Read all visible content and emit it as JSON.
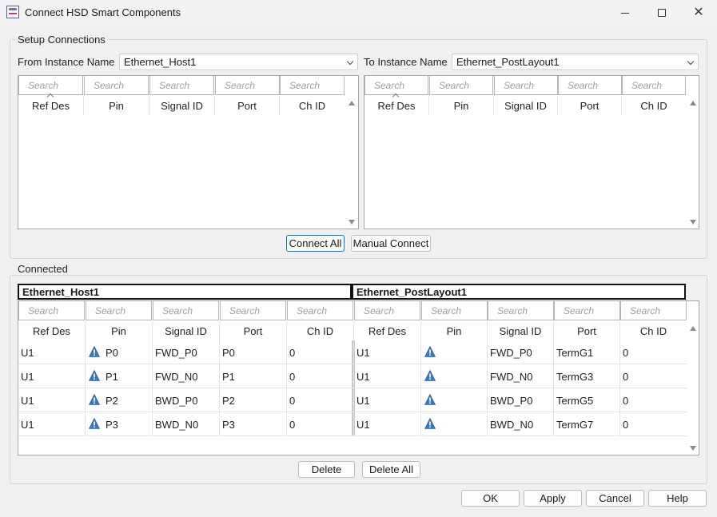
{
  "window": {
    "title": "Connect HSD Smart Components"
  },
  "setup": {
    "group_label": "Setup Connections",
    "from_label": "From Instance Name",
    "from_value": "Ethernet_Host1",
    "to_label": "To Instance Name",
    "to_value": "Ethernet_PostLayout1",
    "search_placeholder": "Search",
    "columns": [
      "Ref Des",
      "Pin",
      "Signal ID",
      "Port",
      "Ch ID"
    ],
    "connect_all_label": "Connect All",
    "manual_connect_label": "Manual Connect"
  },
  "connected": {
    "group_label": "Connected",
    "left_instance": "Ethernet_Host1",
    "right_instance": "Ethernet_PostLayout1",
    "search_placeholder": "Search",
    "columns": [
      "Ref Des",
      "Pin",
      "Signal ID",
      "Port",
      "Ch ID"
    ],
    "left_rows": [
      {
        "ref": "U1",
        "pin": "P0",
        "signal": "FWD_P0",
        "port": "P0",
        "ch": "0"
      },
      {
        "ref": "U1",
        "pin": "P1",
        "signal": "FWD_N0",
        "port": "P1",
        "ch": "0"
      },
      {
        "ref": "U1",
        "pin": "P2",
        "signal": "BWD_P0",
        "port": "P2",
        "ch": "0"
      },
      {
        "ref": "U1",
        "pin": "P3",
        "signal": "BWD_N0",
        "port": "P3",
        "ch": "0"
      }
    ],
    "right_rows": [
      {
        "ref": "U1",
        "pin": "",
        "signal": "FWD_P0",
        "port": "TermG1",
        "ch": "0"
      },
      {
        "ref": "U1",
        "pin": "",
        "signal": "FWD_N0",
        "port": "TermG3",
        "ch": "0"
      },
      {
        "ref": "U1",
        "pin": "",
        "signal": "BWD_P0",
        "port": "TermG5",
        "ch": "0"
      },
      {
        "ref": "U1",
        "pin": "",
        "signal": "BWD_N0",
        "port": "TermG7",
        "ch": "0"
      }
    ],
    "delete_label": "Delete",
    "delete_all_label": "Delete All"
  },
  "footer": {
    "ok_label": "OK",
    "apply_label": "Apply",
    "cancel_label": "Cancel",
    "help_label": "Help"
  },
  "icons": {
    "app": "app-icon",
    "pin_warning": "warning-icon",
    "minimize": "minimize-icon",
    "maximize": "maximize-icon",
    "close": "close-icon"
  },
  "colors": {
    "default_button_border": "#2f6ca8",
    "warning_icon_fill": "#3a78c2"
  }
}
